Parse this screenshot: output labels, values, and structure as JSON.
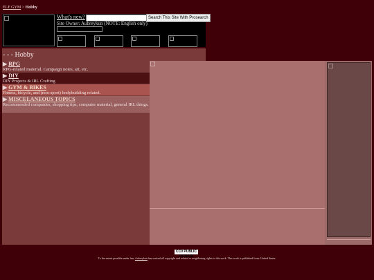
{
  "breadcrumb": {
    "home": "ELF GYM",
    "sep": " > ",
    "current": "Hobby"
  },
  "header": {
    "whats_new": "What's new?",
    "search_placeholder": "",
    "search_button": "Search This Site With Prosearch",
    "owner_text": "Site Owner: Aubreykun (NOTE: English only)"
  },
  "page": {
    "title": "- - - Hobby"
  },
  "categories": [
    {
      "arrow": "▶",
      "name": "RPG",
      "description": "RPG-related material. Campaign notes, art, etc."
    },
    {
      "arrow": "▶",
      "name": "DIY",
      "description": "DIY Projects & IRL Crafting"
    },
    {
      "arrow": "▶",
      "name": "GYM & BIKES",
      "description": "Fitness, bicycle, and (non-sport) bodybuilding related."
    },
    {
      "arrow": "▶",
      "name": "MISCELANEOUS TOPICS",
      "description": "Recommended companies, shopping tips, computer material, general IRL things."
    }
  ],
  "footer": {
    "badge": "CC0 PUBLIC DOMAIN",
    "text_before": "To the extent possible under law,",
    "author": "Aubreykun",
    "text_after": "has waived all copyright and related or neighboring rights to this work. This work is published from: United States."
  },
  "colors": {
    "background": "#3f0007",
    "panel": "#7b3a3a",
    "content": "#a96e6e"
  }
}
